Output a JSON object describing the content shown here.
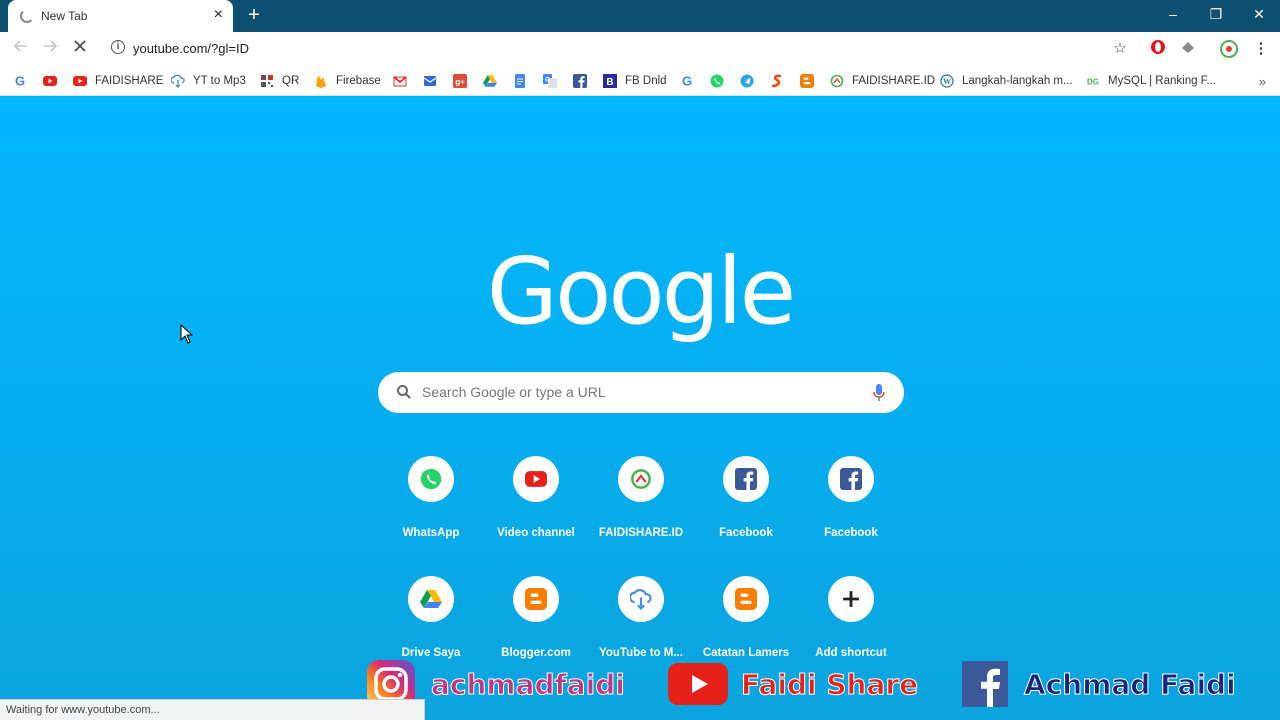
{
  "tab": {
    "title": "New Tab",
    "close": "×"
  },
  "new_tab": "+",
  "window": {
    "minimize": "–",
    "restore": "❐",
    "close": "✕"
  },
  "address": {
    "url": "youtube.com/?gl=ID"
  },
  "bookmarks": [
    {
      "label": "",
      "icon": "google-icon",
      "color": "#4285f4"
    },
    {
      "label": "",
      "icon": "youtube-icon",
      "color": "#e62117"
    },
    {
      "label": "FAIDISHARE",
      "icon": "youtube-icon",
      "color": "#e62117"
    },
    {
      "label": "YT to Mp3",
      "icon": "cloud-download-icon",
      "color": "#4a90d9"
    },
    {
      "label": "QR",
      "icon": "qr-icon",
      "color": "#7a4a4a"
    },
    {
      "label": "Firebase",
      "icon": "firebase-icon",
      "color": "#ffa000"
    },
    {
      "label": "",
      "icon": "gmail-icon",
      "color": "#d93025"
    },
    {
      "label": "",
      "icon": "inbox-icon",
      "color": "#3367d6"
    },
    {
      "label": "",
      "icon": "google-plus-icon",
      "color": "#dd4b39"
    },
    {
      "label": "",
      "icon": "drive-icon",
      "color": "#1fa463"
    },
    {
      "label": "",
      "icon": "docs-icon",
      "color": "#4285f4"
    },
    {
      "label": "",
      "icon": "translate-icon",
      "color": "#4285f4"
    },
    {
      "label": "",
      "icon": "facebook-icon",
      "color": "#3b5998"
    },
    {
      "label": "FB Dnld",
      "icon": "b-icon",
      "color": "#2a2aa0"
    },
    {
      "label": "",
      "icon": "google-icon",
      "color": "#4285f4"
    },
    {
      "label": "",
      "icon": "whatsapp-icon",
      "color": "#25d366"
    },
    {
      "label": "",
      "icon": "telegram-icon",
      "color": "#2ca5e0"
    },
    {
      "label": "",
      "icon": "s-icon",
      "color": "#ff3d00"
    },
    {
      "label": "",
      "icon": "blogger-icon",
      "color": "#f57d00"
    },
    {
      "label": "FAIDISHARE.ID",
      "icon": "faidishare-icon",
      "color": "#4caf50"
    },
    {
      "label": "Langkah-langkah m...",
      "icon": "wordpress-icon",
      "color": "#21759b"
    },
    {
      "label": "MySQL | Ranking F...",
      "icon": "dg-icon",
      "color": "#4caf50"
    }
  ],
  "more_bookmarks": "»",
  "logo": "Google",
  "search": {
    "placeholder": "Search Google or type a URL"
  },
  "shortcuts": [
    {
      "label": "WhatsApp",
      "icon": "whatsapp-icon",
      "color": "#25d366"
    },
    {
      "label": "Video channel",
      "icon": "youtube-icon",
      "color": "#e62117"
    },
    {
      "label": "FAIDISHARE.ID",
      "icon": "faidishare-icon",
      "color": "#4caf50"
    },
    {
      "label": "Facebook",
      "icon": "facebook-icon",
      "color": "#3b5998"
    },
    {
      "label": "Facebook",
      "icon": "facebook-icon",
      "color": "#3b5998"
    },
    {
      "label": "Drive Saya",
      "icon": "drive-icon",
      "color": "#1fa463"
    },
    {
      "label": "Blogger.com",
      "icon": "blogger-icon",
      "color": "#f57d00"
    },
    {
      "label": "YouTube to M...",
      "icon": "cloud-download-icon",
      "color": "#4a90d9"
    },
    {
      "label": "Catatan Lamers",
      "icon": "blogger-icon",
      "color": "#f57d00"
    },
    {
      "label": "Add shortcut",
      "icon": "plus-icon",
      "color": "#222222"
    }
  ],
  "overlay": {
    "instagram": "achmadfaidi",
    "youtube": "Faidi Share",
    "facebook": "Achmad Faidi"
  },
  "status": "Waiting for www.youtube.com..."
}
